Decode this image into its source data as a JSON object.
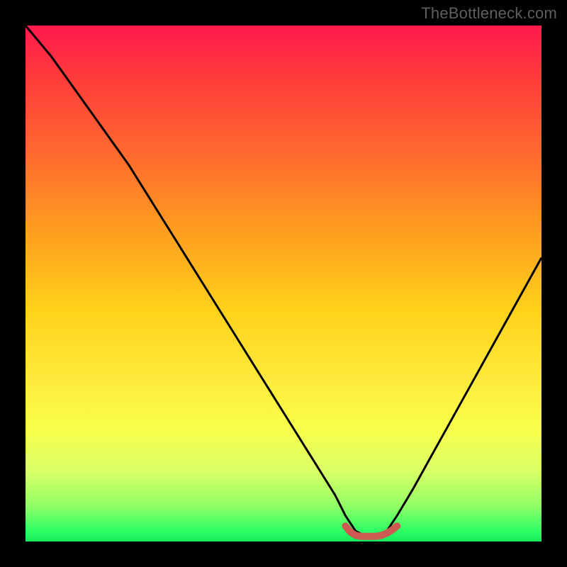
{
  "watermark": "TheBottleneck.com",
  "colors": {
    "frame": "#000000",
    "curve": "#000000",
    "marker": "#cc5a52"
  },
  "chart_data": {
    "type": "line",
    "title": "",
    "xlabel": "",
    "ylabel": "",
    "xlim": [
      0,
      100
    ],
    "ylim": [
      0,
      100
    ],
    "series": [
      {
        "name": "bottleneck-curve",
        "x": [
          0,
          5,
          10,
          15,
          20,
          25,
          30,
          35,
          40,
          45,
          50,
          55,
          60,
          62,
          64,
          66,
          68,
          70,
          72,
          75,
          80,
          85,
          90,
          95,
          100
        ],
        "values": [
          100,
          94,
          87,
          80,
          73,
          65,
          57,
          49,
          41,
          33,
          25,
          17,
          9,
          5,
          2,
          1,
          1,
          2,
          5,
          10,
          19,
          28,
          37,
          46,
          55
        ]
      },
      {
        "name": "optimal-range-marker",
        "x": [
          62,
          63,
          64,
          65,
          66,
          67,
          68,
          69,
          70,
          71,
          72
        ],
        "values": [
          3,
          1.8,
          1.2,
          1,
          1,
          1,
          1,
          1.2,
          1.6,
          2.2,
          3
        ]
      }
    ],
    "background_gradient": {
      "orientation": "vertical",
      "stops": [
        {
          "pos": 0,
          "color": "#ff1a4d"
        },
        {
          "pos": 10,
          "color": "#ff3b3b"
        },
        {
          "pos": 25,
          "color": "#ff6a2f"
        },
        {
          "pos": 40,
          "color": "#ff9e1f"
        },
        {
          "pos": 55,
          "color": "#ffd11a"
        },
        {
          "pos": 68,
          "color": "#ffe93a"
        },
        {
          "pos": 78,
          "color": "#f8ff4a"
        },
        {
          "pos": 86,
          "color": "#dcff66"
        },
        {
          "pos": 93,
          "color": "#94ff66"
        },
        {
          "pos": 98,
          "color": "#2dff66"
        },
        {
          "pos": 100,
          "color": "#18e85c"
        }
      ]
    }
  }
}
